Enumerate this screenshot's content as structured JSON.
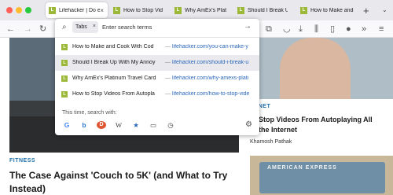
{
  "window": {
    "traffic_lights": [
      "#fe5f57",
      "#febc2e",
      "#28c840"
    ]
  },
  "tabs": [
    {
      "label": "Lifehacker | Do e",
      "active": true
    },
    {
      "label": "How to Stop Vid",
      "active": false
    },
    {
      "label": "Why AmEx's Plat",
      "active": false
    },
    {
      "label": "Should I Break U",
      "active": false
    },
    {
      "label": "How to Make and",
      "active": false
    }
  ],
  "tab_favicon_letter": "L",
  "urlbar": {
    "chip_label": "Tabs",
    "placeholder": "Enter search terms"
  },
  "results": [
    {
      "title": "How to Make and Cook With Cod",
      "url": "lifehacker.com/you-can-make-y",
      "selected": false
    },
    {
      "title": "Should I Break Up With My Annoy",
      "url": "lifehacker.com/should-i-break-u",
      "selected": true
    },
    {
      "title": "Why AmEx's Platinum Travel Card",
      "url": "lifehacker.com/why-amexs-plati",
      "selected": false
    },
    {
      "title": "How to Stop Videos From Autopla",
      "url": "lifehacker.com/how-to-stop-vide",
      "selected": false
    }
  ],
  "result_separator": "—",
  "search_engines_label": "This time, search with:",
  "engines": [
    {
      "name": "google",
      "glyph": "G",
      "color": "#4285f4"
    },
    {
      "name": "bing",
      "glyph": "b",
      "color": "#2b7bd6"
    },
    {
      "name": "duckduckgo",
      "glyph": "D",
      "color": "#de5833"
    },
    {
      "name": "wikipedia",
      "glyph": "W",
      "color": "#333333"
    },
    {
      "name": "bookmarks",
      "glyph": "★",
      "color": "#2b67b9"
    },
    {
      "name": "tabs",
      "glyph": "▭",
      "color": "#444444"
    },
    {
      "name": "history",
      "glyph": "◷",
      "color": "#444444"
    }
  ],
  "page": {
    "left_article": {
      "category": "FITNESS",
      "headline_line1": "The Case Against 'Couch to 5K' (and What to Try",
      "headline_line2": "Instead)"
    },
    "right_article": {
      "category_fragment": "ERNET",
      "headline_line1": "to Stop Videos From Autoplaying All",
      "headline_line2": "er the Internet",
      "author": "Khamosh Pathak"
    },
    "thumb_text": "AMERICAN EXPRESS"
  },
  "colors": {
    "accent_blue": "#1f6fa8",
    "link_blue": "#2b67b9",
    "favicon_green": "#9cb839"
  }
}
